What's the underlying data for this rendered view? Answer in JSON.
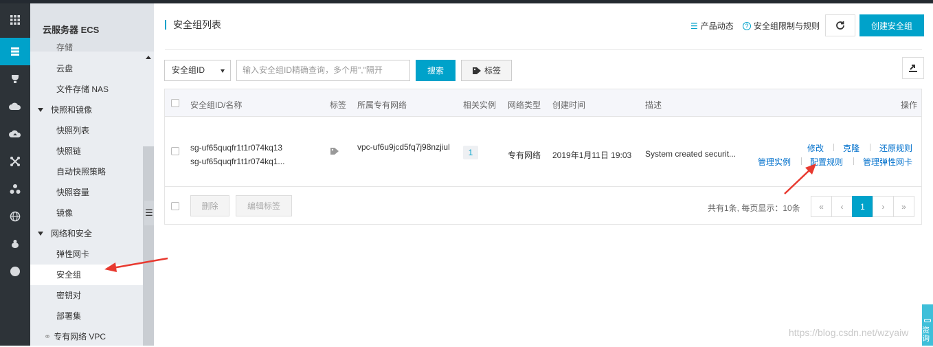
{
  "sidebar": {
    "title": "云服务器 ECS",
    "items": [
      {
        "label": "存储",
        "type": "cut"
      },
      {
        "label": "云盘",
        "type": "sub"
      },
      {
        "label": "文件存储 NAS",
        "type": "sub"
      },
      {
        "label": "快照和镜像",
        "type": "group"
      },
      {
        "label": "快照列表",
        "type": "sub"
      },
      {
        "label": "快照链",
        "type": "sub"
      },
      {
        "label": "自动快照策略",
        "type": "sub"
      },
      {
        "label": "快照容量",
        "type": "sub"
      },
      {
        "label": "镜像",
        "type": "sub"
      },
      {
        "label": "网络和安全",
        "type": "group"
      },
      {
        "label": "弹性网卡",
        "type": "sub"
      },
      {
        "label": "安全组",
        "type": "sub",
        "active": true
      },
      {
        "label": "密钥对",
        "type": "sub"
      },
      {
        "label": "部署集",
        "type": "sub"
      },
      {
        "label": "专有网络 VPC",
        "type": "sub"
      }
    ]
  },
  "header": {
    "title": "安全组列表",
    "product_news": "产品动态",
    "limits_rules": "安全组限制与规则",
    "create_label": "创建安全组"
  },
  "filter": {
    "select_value": "安全组ID",
    "search_placeholder": "输入安全组ID精确查询，多个用\",\"隔开",
    "search_label": "搜索",
    "tag_label": "标签"
  },
  "table": {
    "columns": [
      "安全组ID/名称",
      "标签",
      "所属专有网络",
      "相关实例",
      "网络类型",
      "创建时间",
      "描述",
      "操作"
    ],
    "rows": [
      {
        "id": "sg-uf65quqfr1t1r074kq13",
        "name": "sg-uf65quqfr1t1r074kq1...",
        "vpc": "vpc-uf6u9jcd5fq7j98nzjiul",
        "instances": "1",
        "network_type": "专有网络",
        "created": "2019年1月11日 19:03",
        "description": "System created securit...",
        "ops_line1": [
          "修改",
          "克隆",
          "还原规则"
        ],
        "ops_line2": [
          "管理实例",
          "配置规则",
          "管理弹性网卡"
        ]
      }
    ],
    "footer": {
      "delete_label": "删除",
      "edit_tags_label": "编辑标签",
      "summary": "共有1条, 每页显示：10条",
      "pages": [
        "«",
        "‹",
        "1",
        "›",
        "»"
      ],
      "current_page": "1"
    }
  },
  "watermark": "https://blog.csdn.net/wzyaiw",
  "float_widget": "资询",
  "colors": {
    "accent": "#00a2ca",
    "link": "#0070cc",
    "arrow": "#e8392f",
    "iconbar": "#2d3338"
  }
}
